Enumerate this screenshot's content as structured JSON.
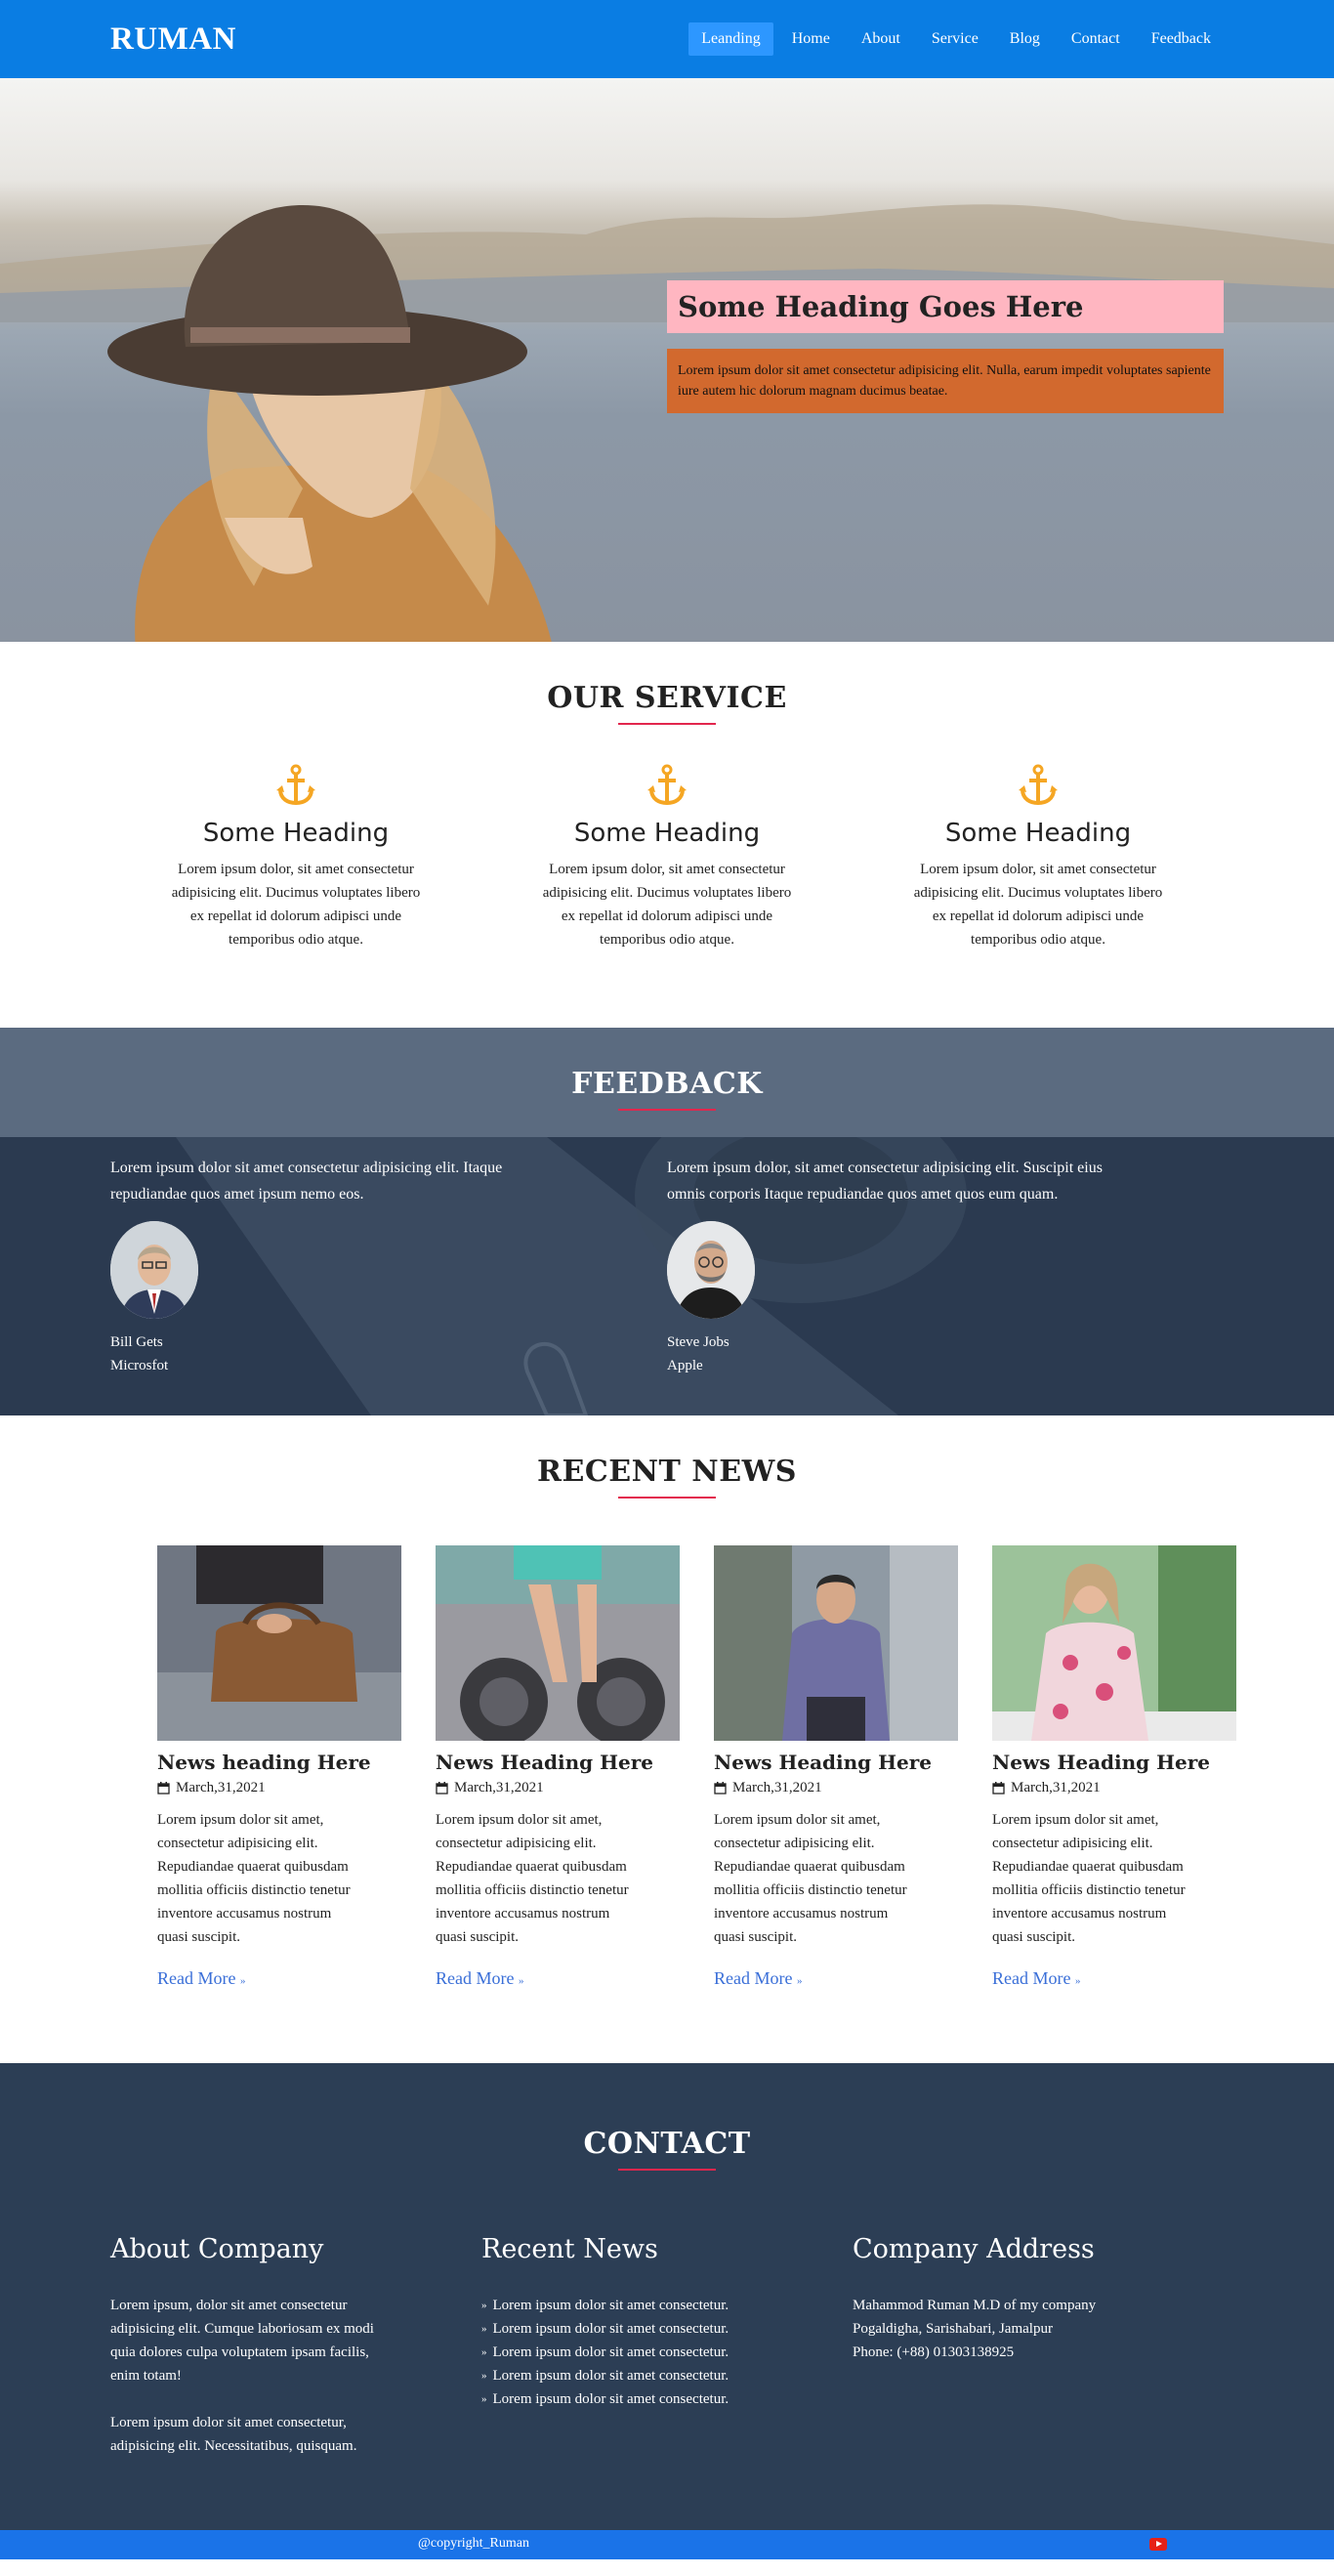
{
  "brand": "RUMAN",
  "nav": [
    "Leanding",
    "Home",
    "About",
    "Service",
    "Blog",
    "Contact",
    "Feedback"
  ],
  "hero": {
    "title": "Some Heading Goes Here",
    "text": "Lorem ipsum dolor sit amet consectetur adipisicing elit. Nulla, earum impedit voluptates sapiente iure autem hic dolorum magnam ducimus beatae."
  },
  "service": {
    "title": "OUR SERVICE",
    "items": [
      {
        "heading": "Some Heading",
        "text": "Lorem ipsum dolor, sit amet consectetur adipisicing elit. Ducimus voluptates libero ex repellat id dolorum adipisci unde temporibus odio atque."
      },
      {
        "heading": "Some Heading",
        "text": "Lorem ipsum dolor, sit amet consectetur adipisicing elit. Ducimus voluptates libero ex repellat id dolorum adipisci unde temporibus odio atque."
      },
      {
        "heading": "Some Heading",
        "text": "Lorem ipsum dolor, sit amet consectetur adipisicing elit. Ducimus voluptates libero ex repellat id dolorum adipisci unde temporibus odio atque."
      }
    ]
  },
  "feedback": {
    "title": "FEEDBACK",
    "items": [
      {
        "quote": "Lorem ipsum dolor sit amet consectetur adipisicing elit. Itaque repudiandae quos amet ipsum nemo eos.",
        "name": "Bill Gets",
        "company": "Microsfot"
      },
      {
        "quote": "Lorem ipsum dolor, sit amet consectetur adipisicing elit. Suscipit eius omnis corporis Itaque repudiandae quos amet quos eum quam.",
        "name": "Steve Jobs",
        "company": "Apple"
      }
    ]
  },
  "news": {
    "title": "RECENT NEWS",
    "items": [
      {
        "heading": "News heading Here",
        "date": "March,31,2021",
        "text": "Lorem ipsum dolor sit amet, consectetur adipisicing elit. Repudiandae quaerat quibusdam mollitia officiis distinctio tenetur inventore accusamus nostrum quasi suscipit.",
        "link": "Read More"
      },
      {
        "heading": "News Heading Here",
        "date": "March,31,2021",
        "text": "Lorem ipsum dolor sit amet, consectetur adipisicing elit. Repudiandae quaerat quibusdam mollitia officiis distinctio tenetur inventore accusamus nostrum quasi suscipit.",
        "link": "Read More"
      },
      {
        "heading": "News Heading Here",
        "date": "March,31,2021",
        "text": "Lorem ipsum dolor sit amet, consectetur adipisicing elit. Repudiandae quaerat quibusdam mollitia officiis distinctio tenetur inventore accusamus nostrum quasi suscipit.",
        "link": "Read More"
      },
      {
        "heading": "News Heading Here",
        "date": "March,31,2021",
        "text": "Lorem ipsum dolor sit amet, consectetur adipisicing elit. Repudiandae quaerat quibusdam mollitia officiis distinctio tenetur inventore accusamus nostrum quasi suscipit.",
        "link": "Read More"
      }
    ]
  },
  "contact": {
    "title": "CONTACT",
    "about": {
      "heading": "About Company",
      "p1": "Lorem ipsum, dolor sit amet consectetur adipisicing elit. Cumque laboriosam ex modi quia dolores culpa voluptatem ipsam facilis, enim totam!",
      "p2": "Lorem ipsum dolor sit amet consectetur, adipisicing elit. Necessitatibus, quisquam."
    },
    "recent": {
      "heading": "Recent News",
      "items": [
        "Lorem ipsum dolor sit amet consectetur.",
        "Lorem ipsum dolor sit amet consectetur.",
        "Lorem ipsum dolor sit amet consectetur.",
        "Lorem ipsum dolor sit amet consectetur.",
        "Lorem ipsum dolor sit amet consectetur."
      ]
    },
    "address": {
      "heading": "Company Address",
      "lines": [
        "Mahammod Ruman M.D of my company",
        "Pogaldigha, Sarishabari, Jamalpur",
        "Phone: (+88) 01303138925"
      ]
    }
  },
  "footer": {
    "copyright": "@copyright_Ruman",
    "social_icon": "youtube-icon"
  },
  "colors": {
    "nav": "#0a7de3",
    "accent_underline": "#e2264d",
    "anchor": "#f5a623",
    "contact_bg": "#2c3e55",
    "link": "#3a6fd8"
  }
}
